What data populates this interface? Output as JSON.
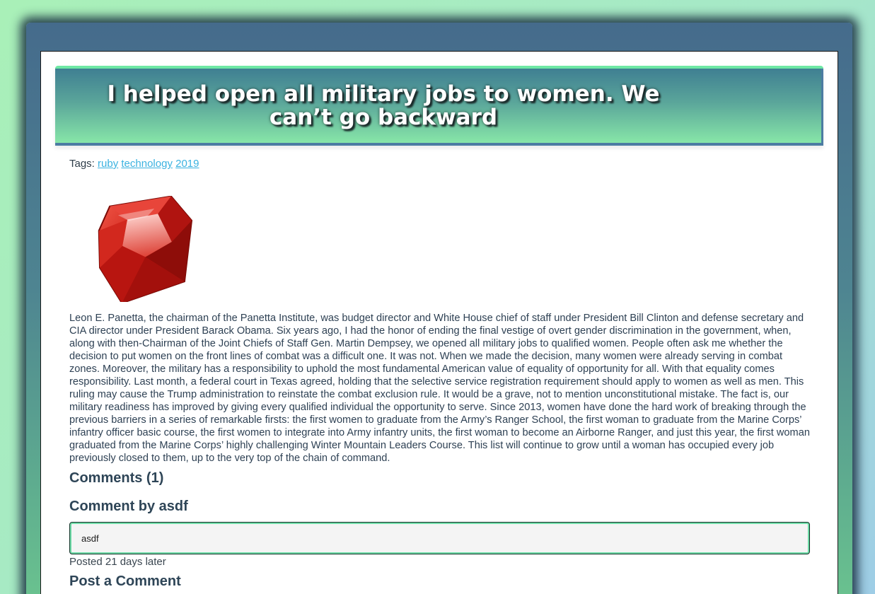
{
  "article": {
    "title": "I helped open all military jobs to women. We can’t go backward",
    "tags_label": "Tags:",
    "tags": [
      "ruby",
      "technology",
      "2019"
    ],
    "image": "ruby-gem-logo",
    "body": "Leon E. Panetta, the chairman of the Panetta Institute, was budget director and White House chief of staff under President Bill Clinton and defense secretary and CIA director under President Barack Obama. Six years ago, I had the honor of ending the final vestige of overt gender discrimination in the government, when, along with then-Chairman of the Joint Chiefs of Staff Gen. Martin Dempsey, we opened all military jobs to qualified women. People often ask me whether the decision to put women on the front lines of combat was a difficult one. It was not. When we made the decision, many women were already serving in combat zones. Moreover, the military has a responsibility to uphold the most fundamental American value of equality of opportunity for all. With that equality comes responsibility. Last month, a federal court in Texas agreed, holding that the selective service registration requirement should apply to women as well as men. This ruling may cause the Trump administration to reinstate the combat exclusion rule. It would be a grave, not to mention unconstitutional mistake. The fact is, our military readiness has improved by giving every qualified individual the opportunity to serve. Since 2013, women have done the hard work of breaking through the previous barriers in a series of remarkable firsts: the first women to graduate from the Army’s Ranger School, the first woman to graduate from the Marine Corps’ infantry officer basic course, the first women to integrate into Army infantry units, the first woman to become an Airborne Ranger, and just this year, the first woman graduated from the Marine Corps’ highly challenging Winter Mountain Leaders Course. This list will continue to grow until a woman has occupied every job previously closed to them, up to the very top of the chain of command."
  },
  "comments": {
    "heading": "Comments (1)",
    "items": [
      {
        "author_line": "Comment by asdf",
        "text": "asdf",
        "posted": "Posted 21 days later"
      }
    ]
  },
  "post_comment": {
    "heading": "Post a Comment"
  },
  "colors": {
    "page_background": "#a9f0b8",
    "frame": "#456b8c",
    "banner_top": "#3f7f92",
    "banner_bottom": "#87e6a8",
    "link": "#3bb2e0",
    "heading_text": "#2e4557"
  }
}
